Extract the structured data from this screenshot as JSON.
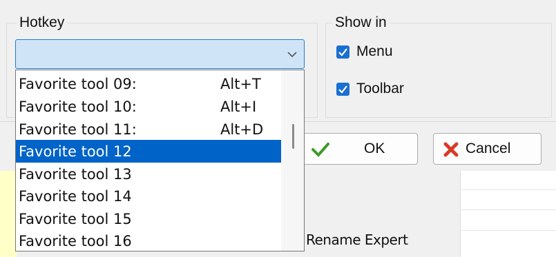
{
  "hotkey_group": {
    "caption": "Hotkey",
    "combo_value": "",
    "dropdown_arrow_icon": "chevron-down"
  },
  "show_in_group": {
    "caption": "Show in",
    "menu": {
      "label": "Menu",
      "checked": true
    },
    "toolbar": {
      "label": "Toolbar",
      "checked": true
    }
  },
  "buttons": {
    "ok": {
      "label": "OK",
      "icon": "green-checkmark",
      "color": "#3c9a2a"
    },
    "cancel": {
      "label": "Cancel",
      "icon": "red-x",
      "color": "#d93a26"
    }
  },
  "background_text": {
    "rename_expert": "Rename Expert"
  },
  "dropdown": {
    "items": [
      {
        "name": "Favorite tool 09:",
        "key": "Alt+T",
        "selected": false
      },
      {
        "name": "Favorite tool 10:",
        "key": "Alt+I",
        "selected": false
      },
      {
        "name": "Favorite tool 11:",
        "key": "Alt+D",
        "selected": false
      },
      {
        "name": "Favorite tool 12",
        "key": "",
        "selected": true
      },
      {
        "name": "Favorite tool 13",
        "key": "",
        "selected": false
      },
      {
        "name": "Favorite tool 14",
        "key": "",
        "selected": false
      },
      {
        "name": "Favorite tool 15",
        "key": "",
        "selected": false
      },
      {
        "name": "Favorite tool 16",
        "key": "",
        "selected": false
      }
    ]
  },
  "colors": {
    "selection": "#0063c8",
    "combo_focus_bg": "#cfe5f7",
    "checkbox": "#1a6fd0"
  }
}
